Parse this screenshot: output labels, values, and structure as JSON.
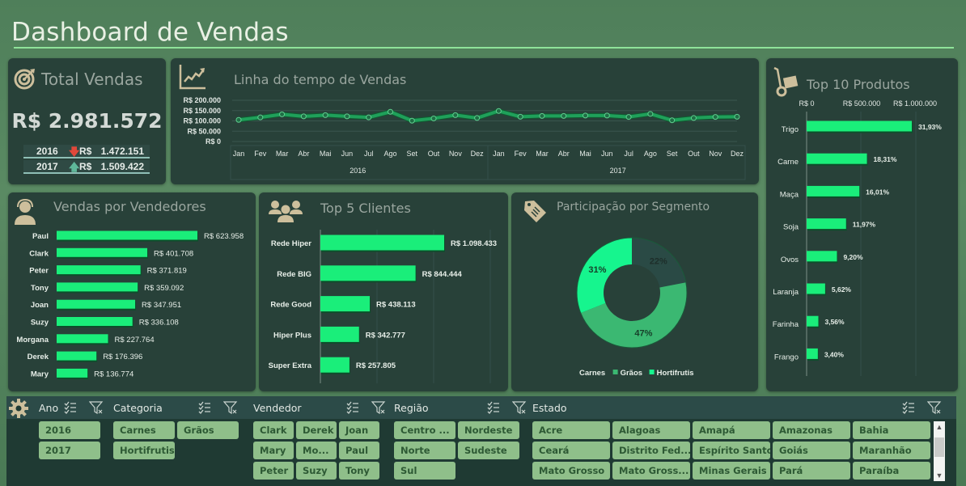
{
  "header": {
    "title": "Dashboard de Vendas"
  },
  "total": {
    "title": "Total Vendas",
    "value": "R$ 2.981.572",
    "rows": [
      {
        "year": "2016",
        "trend": "down",
        "arrow": "🡇",
        "currency": "R$",
        "value": "1.472.151",
        "arrow_color": "#e0483a"
      },
      {
        "year": "2017",
        "trend": "up",
        "arrow": "🡅",
        "currency": "R$",
        "value": "1.509.422",
        "arrow_color": "#5fb89a"
      }
    ]
  },
  "timeline": {
    "title": "Linha do tempo de Vendas",
    "chart_data": {
      "type": "line",
      "title": "Linha do tempo de Vendas",
      "y_ticks": [
        "R$ 0",
        "R$ 50.000",
        "R$ 100.000",
        "R$ 150.000",
        "R$ 200.000"
      ],
      "ylim": [
        0,
        200000
      ],
      "groups": [
        "2016",
        "2017"
      ],
      "months": [
        "Jan",
        "Fev",
        "Mar",
        "Abr",
        "Mai",
        "Jun",
        "Jul",
        "Ago",
        "Set",
        "Out",
        "Nov",
        "Dez"
      ],
      "series": [
        {
          "name": "Vendas",
          "values": [
            105000,
            117000,
            132000,
            122000,
            128000,
            122000,
            117000,
            144000,
            101000,
            112000,
            128000,
            114000,
            148000,
            120000,
            124000,
            124000,
            126000,
            126000,
            119000,
            134000,
            103000,
            114000,
            119000,
            120000
          ]
        }
      ],
      "grid": true,
      "color": "#1fa05a"
    }
  },
  "vendedores": {
    "title": "Vendas por Vendedores",
    "chart_data": {
      "type": "bar",
      "orientation": "horizontal",
      "categories": [
        "Paul",
        "Clark",
        "Peter",
        "Tony",
        "Joan",
        "Suzy",
        "Morgana",
        "Derek",
        "Mary"
      ],
      "values": [
        623958,
        401708,
        371819,
        359092,
        347951,
        336108,
        227764,
        176396,
        136774
      ],
      "labels": [
        "R$ 623.958",
        "R$ 401.708",
        "R$ 371.819",
        "R$ 359.092",
        "R$ 347.951",
        "R$ 336.108",
        "R$ 227.764",
        "R$ 176.396",
        "R$ 136.774"
      ],
      "color": "#1aee7a"
    }
  },
  "clientes": {
    "title": "Top 5 Clientes",
    "chart_data": {
      "type": "bar",
      "orientation": "horizontal",
      "categories": [
        "Rede Hiper",
        "Rede BIG",
        "Rede Good",
        "Hiper Plus",
        "Super Extra"
      ],
      "values": [
        1098433,
        844444,
        438113,
        342777,
        257805
      ],
      "labels": [
        "R$ 1.098.433",
        "R$ 844.444",
        "R$ 438.113",
        "R$ 342.777",
        "R$ 257.805"
      ],
      "color": "#1aee7a"
    }
  },
  "segmento": {
    "title": "Participação por Segmento",
    "chart_data": {
      "type": "pie",
      "variant": "donut",
      "categories": [
        "Carnes",
        "Grãos",
        "Hortifrutis"
      ],
      "values": [
        22,
        47,
        31
      ],
      "labels": [
        "22%",
        "47%",
        "31%"
      ],
      "colors": [
        "#2a4a45",
        "#3bb872",
        "#16f58e"
      ],
      "legend": "bottom"
    }
  },
  "produtos": {
    "title": "Top 10 Produtos",
    "chart_data": {
      "type": "bar",
      "orientation": "horizontal",
      "x_ticks": [
        "R$ 0",
        "R$ 500.000",
        "R$ 1.000.000"
      ],
      "xlim": [
        0,
        1000000
      ],
      "categories": [
        "Trigo",
        "Carne",
        "Maça",
        "Soja",
        "Ovos",
        "Laranja",
        "Farinha",
        "Frango"
      ],
      "values": [
        31.93,
        18.31,
        16.01,
        11.97,
        9.2,
        5.62,
        3.56,
        3.4
      ],
      "labels": [
        "31,93%",
        "18,31%",
        "16,01%",
        "11,97%",
        "9,20%",
        "5,62%",
        "3,56%",
        "3,40%"
      ],
      "color": "#1aee7a"
    }
  },
  "slicers": [
    {
      "title": "Ano",
      "items": [
        "2016",
        "2017"
      ]
    },
    {
      "title": "Categoria",
      "items": [
        "Carnes",
        "Grãos",
        "Hortifrutis"
      ]
    },
    {
      "title": "Vendedor",
      "items": [
        "Clark",
        "Derek",
        "Joan",
        "Mary",
        "Mo...",
        "Paul",
        "Peter",
        "Suzy",
        "Tony"
      ]
    },
    {
      "title": "Região",
      "items": [
        "Centro ...",
        "Nordeste",
        "Norte",
        "Sudeste",
        "Sul"
      ]
    },
    {
      "title": "Estado",
      "items": [
        "Acre",
        "Alagoas",
        "Amapá",
        "Amazonas",
        "Bahia",
        "Ceará",
        "Distrito Fed...",
        "Espírito Santo",
        "Goiás",
        "Maranhão",
        "Mato Grosso",
        "Mato Gross...",
        "Minas Gerais",
        "Pará",
        "Paraíba"
      ]
    }
  ]
}
